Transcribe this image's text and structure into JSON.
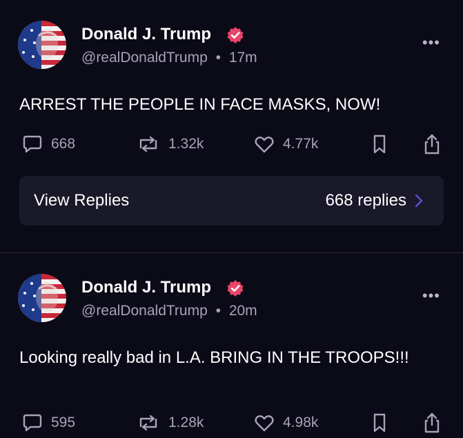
{
  "posts": [
    {
      "author": "Donald J. Trump",
      "handle": "@realDonaldTrump",
      "time": "17m",
      "text": "ARREST THE PEOPLE IN FACE MASKS, NOW!",
      "replies": "668",
      "retruths": "1.32k",
      "likes": "4.77k",
      "view_replies_label": "View Replies",
      "replies_count_label": "668 replies"
    },
    {
      "author": "Donald J. Trump",
      "handle": "@realDonaldTrump",
      "time": "20m",
      "text": "Looking really bad in L.A. BRING IN THE TROOPS!!!",
      "replies": "595",
      "retruths": "1.28k",
      "likes": "4.98k"
    }
  ],
  "ui": {
    "separator": "•",
    "more_glyph": "•••",
    "verified_color": "#e8456b",
    "background_color": "#0b0a17",
    "card_color": "#1a1929",
    "muted_text_color": "#a7a4b8",
    "chevron_color": "#5b4fd6"
  }
}
